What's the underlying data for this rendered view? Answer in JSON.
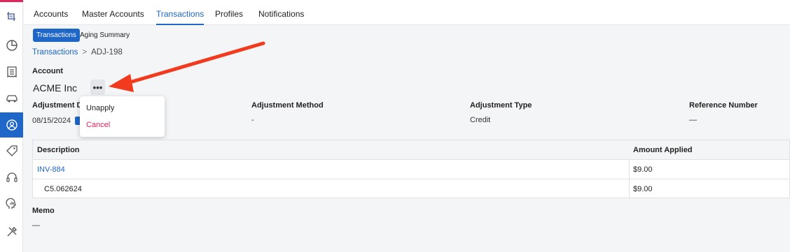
{
  "nav_tabs": [
    "Accounts",
    "Master Accounts",
    "Transactions",
    "Profiles",
    "Notifications"
  ],
  "sub_tabs": [
    "Transactions",
    "Aging Summary"
  ],
  "breadcrumb": {
    "parent": "Transactions",
    "separator": ">",
    "current": "ADJ-198"
  },
  "account": {
    "label": "Account",
    "name": "ACME Inc",
    "more_label": "•••"
  },
  "menu": {
    "unapply": "Unapply",
    "cancel": "Cancel"
  },
  "fields": {
    "adjustment_date": {
      "label": "Adjustment Da",
      "value": "08/15/2024"
    },
    "adjustment_method": {
      "label": "Adjustment Method",
      "value": "-"
    },
    "adjustment_type": {
      "label": "Adjustment Type",
      "value": "Credit"
    },
    "reference_number": {
      "label": "Reference Number",
      "value": "—"
    }
  },
  "table": {
    "headers": [
      "Description",
      "Amount Applied"
    ],
    "rows": [
      {
        "description": "INV-884",
        "amount": "$9.00"
      },
      {
        "description": "C5.062624",
        "amount": "$9.00"
      }
    ]
  },
  "memo": {
    "label": "Memo",
    "value": "—"
  },
  "sidebar_icons": [
    "logo-icon",
    "pie-chart-icon",
    "receipt-icon",
    "car-icon",
    "user-circle-icon",
    "tag-icon",
    "headset-icon",
    "chart-head-icon",
    "tools-icon"
  ],
  "colors": {
    "accent": "#1e66c7",
    "danger": "#e0245e",
    "annotation_arrow": "#f23a1f"
  }
}
